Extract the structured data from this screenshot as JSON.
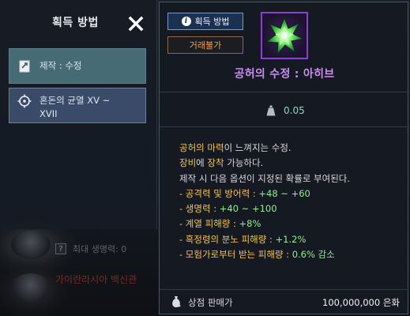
{
  "background": {
    "row1_badge": "?",
    "row1_text": "최대 생명력: 0",
    "row2_text": "가이란라시아 백신관"
  },
  "acquisition_panel": {
    "title": "획득 방법",
    "close_icon": "close-icon",
    "items": [
      {
        "label": "제작 : 수정",
        "icon": "craft-scroll-icon"
      },
      {
        "label_line1": "혼돈의 균열 XV ~",
        "label_line2": "XVII",
        "icon": "crosshair-icon"
      }
    ]
  },
  "tooltip": {
    "method_button": "획득 방법",
    "untradeable_badge": "거래불가",
    "item_name": "공허의 수정 : 아히브",
    "item_icon": "green-crystal-icon",
    "weight": "0.05",
    "description": {
      "line1_hl": "공허의 마력",
      "line1_rest": "이 느껴지는 수정.",
      "line2_hl1": "장비",
      "line2_mid": "에 ",
      "line2_hl2": "장착",
      "line2_rest": " 가능하다.",
      "line3": "제작 시 다음 옵션이 지정된 확률로 부여된다."
    },
    "options": [
      {
        "name": "- 공격력 및 방어력 : ",
        "value": "+48 ~ +60"
      },
      {
        "name": "- 생명력 : ",
        "value": "+40 ~ +100"
      },
      {
        "name": "- 계열 피해량 : ",
        "value": "+8%"
      },
      {
        "name": "- 흑정령의 분노 피해량 : ",
        "value": "+1.2%"
      },
      {
        "name": "- 모험가로부터 받는 피해량 : ",
        "value": "0.6% 감소"
      }
    ],
    "sell_label": "상점 판매가",
    "sell_price": "100,000,000 은화"
  },
  "colors": {
    "item_name": "#c990f2",
    "highlight": "#f5c451",
    "option_value": "#8ff08f",
    "untradeable": "#f0a24a",
    "weight": "#8fd6c6"
  }
}
